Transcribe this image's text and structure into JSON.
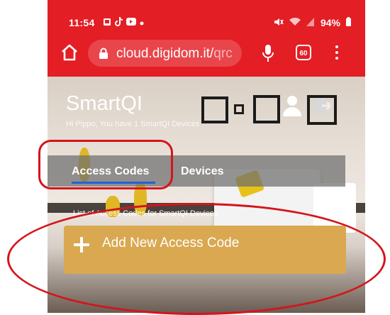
{
  "status_bar": {
    "time": "11:54",
    "battery": "94%",
    "icons_left": [
      "gallery-icon",
      "tiktok-icon",
      "youtube-icon",
      "dot-icon"
    ],
    "icons_right": [
      "mute-icon",
      "wifi-icon",
      "signal-icon",
      "battery-icon"
    ]
  },
  "browser": {
    "url_host": "cloud.digidom.it/",
    "url_path": "qrc",
    "tab_count": "60",
    "theme_color": "#e31e24"
  },
  "header": {
    "title": "SmartQI",
    "subtitle": "Hi Pippo, You have 1 SmartQI Devices"
  },
  "tabs": [
    {
      "label": "Access Codes",
      "active": true
    },
    {
      "label": "Devices",
      "active": false
    }
  ],
  "list_caption": "List of Access Codes for SmartQI Devices",
  "add_button": {
    "label": "Add New Access Code",
    "color": "#d9a850"
  },
  "annotation_color": "#d5141b"
}
